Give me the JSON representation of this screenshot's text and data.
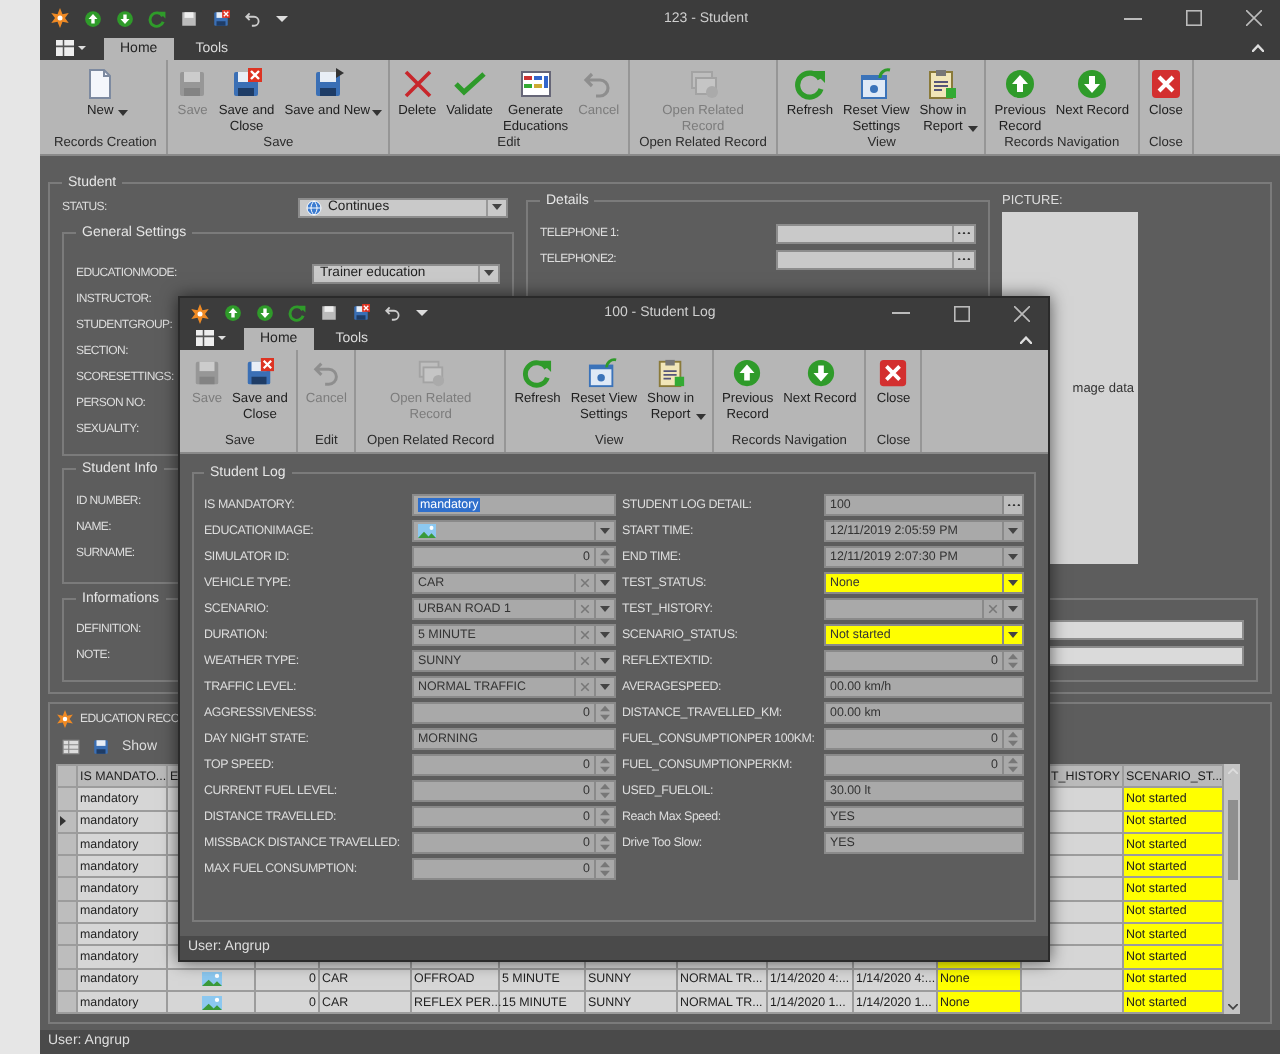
{
  "main_window": {
    "title": "123 - Student",
    "tabs": [
      {
        "label": "Home",
        "selected": true
      },
      {
        "label": "Tools",
        "selected": false
      }
    ],
    "ribbon": [
      {
        "label": "Records Creation",
        "buttons": [
          {
            "label": "New",
            "kind": "new",
            "disabled": false,
            "dropdown": true
          }
        ]
      },
      {
        "label": "Save",
        "buttons": [
          {
            "label": "Save",
            "kind": "save",
            "disabled": true,
            "dropdown": false
          },
          {
            "label": "Save and\nClose",
            "kind": "save-and-close",
            "disabled": false,
            "dropdown": false
          },
          {
            "label": "Save and New",
            "kind": "save-and-new",
            "disabled": false,
            "dropdown": true
          }
        ]
      },
      {
        "label": "Edit",
        "buttons": [
          {
            "label": "Delete",
            "kind": "delete",
            "disabled": false,
            "dropdown": false
          },
          {
            "label": "Validate",
            "kind": "validate",
            "disabled": false,
            "dropdown": false
          },
          {
            "label": "Generate\nEducations",
            "kind": "generate",
            "disabled": false,
            "dropdown": false
          },
          {
            "label": "Cancel",
            "kind": "cancel",
            "disabled": true,
            "dropdown": false
          }
        ]
      },
      {
        "label": "Open Related Record",
        "buttons": [
          {
            "label": "Open Related\nRecord",
            "kind": "open-related",
            "disabled": true,
            "dropdown": false
          }
        ]
      },
      {
        "label": "View",
        "buttons": [
          {
            "label": "Refresh",
            "kind": "refresh",
            "disabled": false,
            "dropdown": false
          },
          {
            "label": "Reset View\nSettings",
            "kind": "reset-view",
            "disabled": false,
            "dropdown": false
          },
          {
            "label": "Show in\nReport",
            "kind": "show-in-report",
            "disabled": false,
            "dropdown": true
          }
        ]
      },
      {
        "label": "Records Navigation",
        "buttons": [
          {
            "label": "Previous\nRecord",
            "kind": "previous-record",
            "disabled": false,
            "dropdown": false
          },
          {
            "label": "Next Record",
            "kind": "next-record",
            "disabled": false,
            "dropdown": false
          }
        ]
      },
      {
        "label": "Close",
        "buttons": [
          {
            "label": "Close",
            "kind": "close",
            "disabled": false,
            "dropdown": false
          }
        ]
      }
    ],
    "student": {
      "title": "Student",
      "status_label": "STATUS:",
      "status_value": "Continues",
      "general_settings": {
        "title": "General Settings",
        "fields": [
          {
            "label": "EDUCATIONMODE:",
            "value": "Trainer education"
          },
          {
            "label": "INSTRUCTOR:"
          },
          {
            "label": "STUDENTGROUP:"
          },
          {
            "label": "SECTION:"
          },
          {
            "label": "SCORESETTINGS:"
          },
          {
            "label": "PERSON NO:"
          },
          {
            "label": "SEXUALITY:"
          }
        ]
      },
      "details": {
        "title": "Details",
        "fields": [
          {
            "label": "TELEPHONE 1:"
          },
          {
            "label": "TELEPHONE2:"
          }
        ]
      },
      "picture": {
        "label": "PICTURE:",
        "text": "mage data"
      },
      "student_info": {
        "title": "Student Info",
        "fields": [
          {
            "label": "ID NUMBER:"
          },
          {
            "label": "NAME:"
          },
          {
            "label": "SURNAME:"
          }
        ]
      },
      "informations": {
        "title": "Informations",
        "fields": [
          {
            "label": "DEFINITION:"
          },
          {
            "label": "NOTE:"
          }
        ]
      }
    },
    "education_records": {
      "title": "EDUCATION RECO",
      "toolbar_label": "Show",
      "columns": [
        {
          "label": "IS MANDATO...",
          "highlighted": false
        },
        {
          "label": "E",
          "highlighted": false
        },
        {
          "highlighted": false
        },
        {
          "highlighted": false
        },
        {
          "highlighted": false
        },
        {
          "highlighted": false
        },
        {
          "highlighted": false
        },
        {
          "highlighted": false
        },
        {
          "highlighted": false
        },
        {
          "highlighted": false
        },
        {
          "highlighted": true
        },
        {
          "label": "T_HISTORY",
          "highlighted": false
        },
        {
          "label": "SCENARIO_ST...",
          "highlighted": true
        }
      ],
      "rows": [
        {
          "current": false,
          "cells": [
            "mandatory",
            null,
            null,
            null,
            null,
            null,
            null,
            null,
            null,
            null,
            null,
            null,
            "Not started"
          ]
        },
        {
          "current": true,
          "cells": [
            "mandatory",
            null,
            null,
            null,
            null,
            null,
            null,
            null,
            null,
            null,
            null,
            null,
            "Not started"
          ]
        },
        {
          "current": false,
          "cells": [
            "mandatory",
            null,
            null,
            null,
            null,
            null,
            null,
            null,
            null,
            null,
            null,
            null,
            "Not started"
          ]
        },
        {
          "current": false,
          "cells": [
            "mandatory",
            null,
            null,
            null,
            null,
            null,
            null,
            null,
            null,
            null,
            null,
            null,
            "Not started"
          ]
        },
        {
          "current": false,
          "cells": [
            "mandatory",
            null,
            null,
            null,
            null,
            null,
            null,
            null,
            null,
            null,
            null,
            null,
            "Not started"
          ]
        },
        {
          "current": false,
          "cells": [
            "mandatory",
            null,
            null,
            null,
            null,
            null,
            null,
            null,
            null,
            null,
            null,
            null,
            "Not started"
          ]
        },
        {
          "current": false,
          "cells": [
            "mandatory",
            null,
            null,
            null,
            null,
            null,
            null,
            null,
            null,
            null,
            null,
            null,
            "Not started"
          ]
        },
        {
          "current": false,
          "cells": [
            "mandatory",
            null,
            null,
            null,
            null,
            null,
            null,
            null,
            null,
            null,
            null,
            null,
            "Not started"
          ]
        },
        {
          "current": false,
          "has_image": true,
          "cells": [
            "mandatory",
            null,
            "0",
            "CAR",
            "OFFROAD",
            "5 MINUTE",
            "SUNNY",
            "NORMAL TR...",
            "1/14/2020 4:...",
            "1/14/2020 4:...",
            "None",
            null,
            "Not started"
          ]
        },
        {
          "current": false,
          "has_image": true,
          "cells": [
            "mandatory",
            null,
            "0",
            "CAR",
            "REFLEX PER...",
            "15 MINUTE",
            "SUNNY",
            "NORMAL TR...",
            "1/14/2020 1...",
            "1/14/2020 1...",
            "None",
            null,
            "Not started"
          ]
        }
      ]
    },
    "status_bar": "User: Angrup"
  },
  "dialog": {
    "title": "100 - Student Log",
    "tabs": [
      {
        "label": "Home",
        "selected": true
      },
      {
        "label": "Tools",
        "selected": false
      }
    ],
    "ribbon": [
      {
        "label": "Save",
        "buttons": [
          {
            "label": "Save",
            "kind": "save",
            "disabled": true,
            "dropdown": false
          },
          {
            "label": "Save and\nClose",
            "kind": "save-and-close",
            "disabled": false,
            "dropdown": false
          }
        ]
      },
      {
        "label": "Edit",
        "buttons": [
          {
            "label": "Cancel",
            "kind": "cancel",
            "disabled": true,
            "dropdown": false
          }
        ]
      },
      {
        "label": "Open Related Record",
        "buttons": [
          {
            "label": "Open Related\nRecord",
            "kind": "open-related",
            "disabled": true,
            "dropdown": false
          }
        ]
      },
      {
        "label": "View",
        "buttons": [
          {
            "label": "Refresh",
            "kind": "refresh",
            "disabled": false,
            "dropdown": false
          },
          {
            "label": "Reset View\nSettings",
            "kind": "reset-view",
            "disabled": false,
            "dropdown": false
          },
          {
            "label": "Show in\nReport",
            "kind": "show-in-report",
            "disabled": false,
            "dropdown": true
          }
        ]
      },
      {
        "label": "Records Navigation",
        "buttons": [
          {
            "label": "Previous\nRecord",
            "kind": "previous-record",
            "disabled": false,
            "dropdown": false
          },
          {
            "label": "Next Record",
            "kind": "next-record",
            "disabled": false,
            "dropdown": false
          }
        ]
      },
      {
        "label": "Close",
        "buttons": [
          {
            "label": "Close",
            "kind": "close",
            "disabled": false,
            "dropdown": false
          }
        ]
      }
    ],
    "section_title": "Student Log",
    "left_fields": [
      {
        "label": "IS MANDATORY:",
        "kind": "text",
        "value": "mandatory",
        "text_selected": true,
        "highlighted": false
      },
      {
        "label": "EDUCATIONIMAGE:",
        "kind": "image",
        "highlighted": false
      },
      {
        "label": "SIMULATOR ID:",
        "kind": "spin",
        "value": "0",
        "text_selected": false,
        "highlighted": false
      },
      {
        "label": "VEHICLE TYPE:",
        "kind": "clear",
        "value": "CAR",
        "text_selected": false,
        "highlighted": false
      },
      {
        "label": "SCENARIO:",
        "kind": "clear",
        "value": "URBAN ROAD 1",
        "text_selected": false,
        "highlighted": false
      },
      {
        "label": "DURATION:",
        "kind": "clear",
        "value": "5 MINUTE",
        "text_selected": false,
        "highlighted": false
      },
      {
        "label": "WEATHER TYPE:",
        "kind": "clear",
        "value": "SUNNY",
        "text_selected": false,
        "highlighted": false
      },
      {
        "label": "TRAFFIC LEVEL:",
        "kind": "clear",
        "value": "NORMAL TRAFFIC",
        "text_selected": false,
        "highlighted": false
      },
      {
        "label": "AGGRESSIVENESS:",
        "kind": "spin",
        "value": "0",
        "text_selected": false,
        "highlighted": false
      },
      {
        "label": "DAY NIGHT STATE:",
        "kind": "text",
        "value": "MORNING",
        "text_selected": false,
        "highlighted": false
      },
      {
        "label": "TOP SPEED:",
        "kind": "spin",
        "value": "0",
        "text_selected": false,
        "highlighted": false
      },
      {
        "label": "CURRENT FUEL LEVEL:",
        "kind": "spin",
        "value": "0",
        "text_selected": false,
        "highlighted": false
      },
      {
        "label": "DISTANCE TRAVELLED:",
        "kind": "spin",
        "value": "0",
        "text_selected": false,
        "highlighted": false
      },
      {
        "label": "MISSBACK DISTANCE TRAVELLED:",
        "kind": "spin",
        "value": "0",
        "text_selected": false,
        "highlighted": false
      },
      {
        "label": "MAX FUEL CONSUMPTION:",
        "kind": "spin",
        "value": "0",
        "text_selected": false,
        "highlighted": false
      }
    ],
    "right_fields": [
      {
        "label": "STUDENT LOG DETAIL:",
        "kind": "ellipsis",
        "value": "100",
        "text_selected": false,
        "highlighted": false
      },
      {
        "label": "START TIME:",
        "kind": "combo",
        "value": "12/11/2019 2:05:59 PM",
        "text_selected": false,
        "highlighted": false
      },
      {
        "label": "END TIME:",
        "kind": "combo",
        "value": "12/11/2019 2:07:30 PM",
        "text_selected": false,
        "highlighted": false
      },
      {
        "label": "TEST_STATUS:",
        "kind": "combo",
        "value": "None",
        "text_selected": false,
        "highlighted": true
      },
      {
        "label": "TEST_HISTORY:",
        "kind": "clear",
        "highlighted": false
      },
      {
        "label": "SCENARIO_STATUS:",
        "kind": "combo",
        "value": "Not started",
        "text_selected": false,
        "highlighted": true
      },
      {
        "label": "REFLEXTEXTID:",
        "kind": "spin",
        "value": "0",
        "text_selected": false,
        "highlighted": false
      },
      {
        "label": "AVERAGESPEED:",
        "kind": "text",
        "value": "00.00 km/h",
        "text_selected": false,
        "highlighted": false
      },
      {
        "label": "DISTANCE_TRAVELLED_KM:",
        "kind": "text",
        "value": "00.00 km",
        "text_selected": false,
        "highlighted": false
      },
      {
        "label": "FUEL_CONSUMPTIONPER 100KM:",
        "kind": "spin",
        "value": "0",
        "text_selected": false,
        "highlighted": false
      },
      {
        "label": "FUEL_CONSUMPTIONPERKM:",
        "kind": "spin",
        "value": "0",
        "text_selected": false,
        "highlighted": false
      },
      {
        "label": "USED_FUELOIL:",
        "kind": "text",
        "value": "30.00 lt",
        "text_selected": false,
        "highlighted": false
      },
      {
        "label": "Reach Max Speed:",
        "kind": "text",
        "value": "YES",
        "text_selected": false,
        "highlighted": false
      },
      {
        "label": "Drive Too Slow:",
        "kind": "text",
        "value": "YES",
        "text_selected": false,
        "highlighted": false
      }
    ],
    "status_bar": "User: Angrup"
  }
}
